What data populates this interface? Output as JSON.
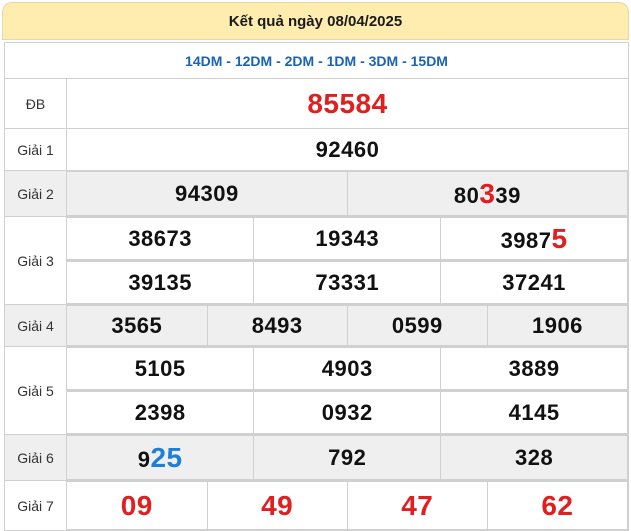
{
  "header": {
    "title": "Kết quả ngày 08/04/2025"
  },
  "codes": "14DM - 12DM - 2DM - 1DM - 3DM - 15DM",
  "db": {
    "label": "ĐB",
    "value": "85584"
  },
  "g1": {
    "label": "Giải 1",
    "values": [
      "92460"
    ]
  },
  "g2": {
    "label": "Giải 2",
    "values": [
      {
        "pre": "94309",
        "hl": "",
        "post": ""
      },
      {
        "pre": "80",
        "hl": "3",
        "post": "39"
      }
    ]
  },
  "g3": {
    "label": "Giải 3",
    "row1": [
      {
        "pre": "38673",
        "hl": ""
      },
      {
        "pre": "19343",
        "hl": ""
      },
      {
        "pre": "3987",
        "hl": "5"
      }
    ],
    "row2": [
      "39135",
      "73331",
      "37241"
    ]
  },
  "g4": {
    "label": "Giải 4",
    "values": [
      "3565",
      "8493",
      "0599",
      "1906"
    ]
  },
  "g5": {
    "label": "Giải 5",
    "row1": [
      "5105",
      "4903",
      "3889"
    ],
    "row2": [
      "2398",
      "0932",
      "4145"
    ]
  },
  "g6": {
    "label": "Giải 6",
    "values": [
      {
        "pre": "9",
        "hl": "25"
      },
      {
        "pre": "792",
        "hl": ""
      },
      {
        "pre": "328",
        "hl": ""
      }
    ]
  },
  "g7": {
    "label": "Giải 7",
    "values": [
      "09",
      "49",
      "47",
      "62"
    ]
  },
  "colors": {
    "highlight_red": "#e02020",
    "highlight_blue": "#1e7fd6",
    "codes_blue": "#1b62b3",
    "header_bg": "#ffedb0"
  }
}
